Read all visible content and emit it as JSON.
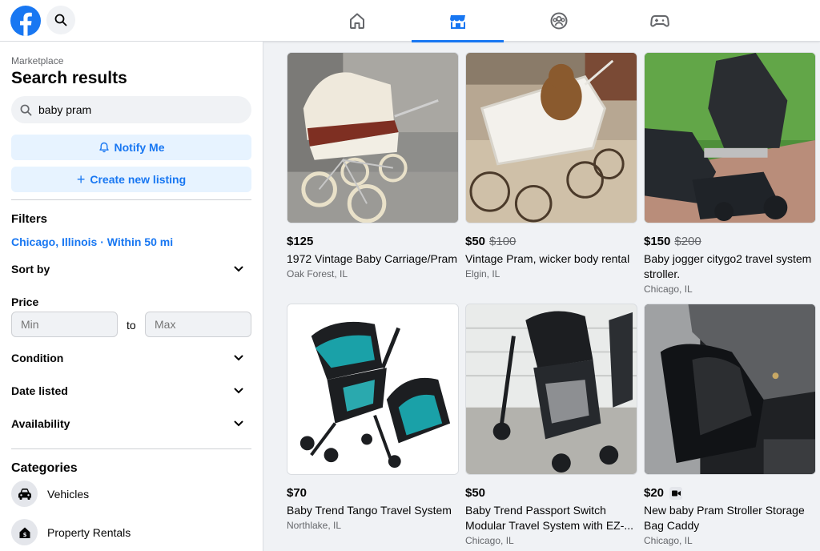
{
  "nav": {
    "tabs": [
      {
        "name": "home",
        "icon": "home-icon",
        "active": false
      },
      {
        "name": "marketplace",
        "icon": "marketplace-icon",
        "active": true
      },
      {
        "name": "groups",
        "icon": "groups-icon",
        "active": false
      },
      {
        "name": "gaming",
        "icon": "gaming-icon",
        "active": false
      }
    ],
    "accent": "#1877f2"
  },
  "sidebar": {
    "breadcrumb": "Marketplace",
    "title": "Search results",
    "search": {
      "value": "baby pram",
      "icon": "search-icon"
    },
    "notify_label": "Notify Me",
    "create_label": "Create new listing",
    "filters_title": "Filters",
    "location": "Chicago, Illinois · Within 50 mi",
    "sort_label": "Sort by",
    "price_label": "Price",
    "price_min_placeholder": "Min",
    "price_to": "to",
    "price_max_placeholder": "Max",
    "condition_label": "Condition",
    "date_label": "Date listed",
    "availability_label": "Availability",
    "categories_title": "Categories",
    "categories": [
      {
        "label": "Vehicles",
        "icon": "car-icon"
      },
      {
        "label": "Property Rentals",
        "icon": "house-dollar-icon"
      }
    ]
  },
  "listings": [
    {
      "price": "$125",
      "old_price": "",
      "title": "1972 Vintage Baby Carriage/Pram",
      "location": "Oak Forest, IL"
    },
    {
      "price": "$50",
      "old_price": "$100",
      "title": "Vintage Pram, wicker body rental",
      "location": "Elgin, IL"
    },
    {
      "price": "$150",
      "old_price": "$200",
      "title": "Baby jogger citygo2 travel system stroller.",
      "location": "Chicago, IL"
    },
    {
      "price": "$70",
      "old_price": "",
      "title": "Baby Trend Tango Travel System",
      "location": "Northlake, IL"
    },
    {
      "price": "$50",
      "old_price": "",
      "title": "Baby Trend Passport Switch Modular Travel System with EZ-...",
      "location": "Chicago, IL"
    },
    {
      "price": "$20",
      "old_price": "",
      "has_video": true,
      "title": "New baby Pram Stroller Storage Bag Caddy",
      "location": "Chicago, IL"
    }
  ]
}
